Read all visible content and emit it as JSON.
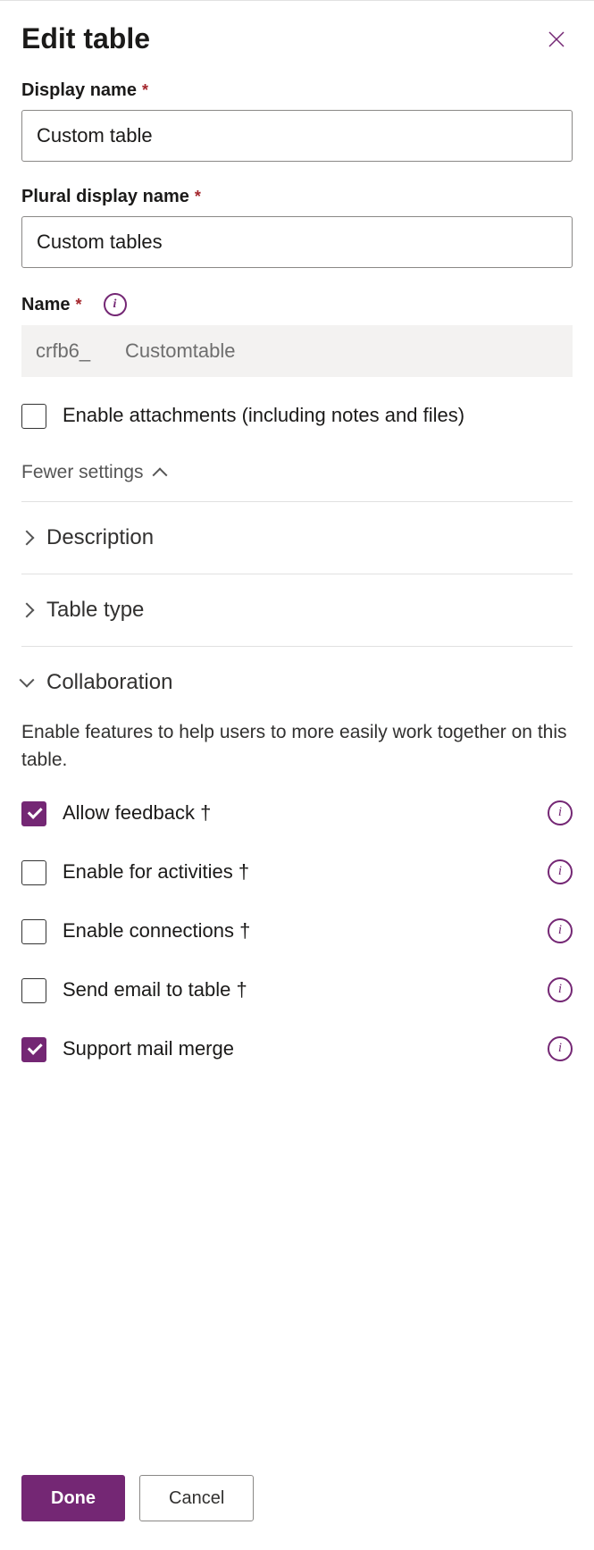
{
  "header": {
    "title": "Edit table"
  },
  "fields": {
    "display_name": {
      "label": "Display name",
      "value": "Custom table"
    },
    "plural_name": {
      "label": "Plural display name",
      "value": "Custom tables"
    },
    "name": {
      "label": "Name",
      "prefix": "crfb6_",
      "value": "Customtable"
    },
    "enable_attachments_label": "Enable attachments (including notes and files)"
  },
  "toggle": {
    "fewer_settings": "Fewer settings"
  },
  "sections": {
    "description": "Description",
    "table_type": "Table type",
    "collaboration": {
      "title": "Collaboration",
      "desc": "Enable features to help users to more easily work together on this table.",
      "items": {
        "allow_feedback": "Allow feedback †",
        "enable_activities": "Enable for activities †",
        "enable_connections": "Enable connections †",
        "send_email": "Send email to table †",
        "support_mail_merge": "Support mail merge"
      }
    }
  },
  "footer": {
    "done": "Done",
    "cancel": "Cancel"
  }
}
